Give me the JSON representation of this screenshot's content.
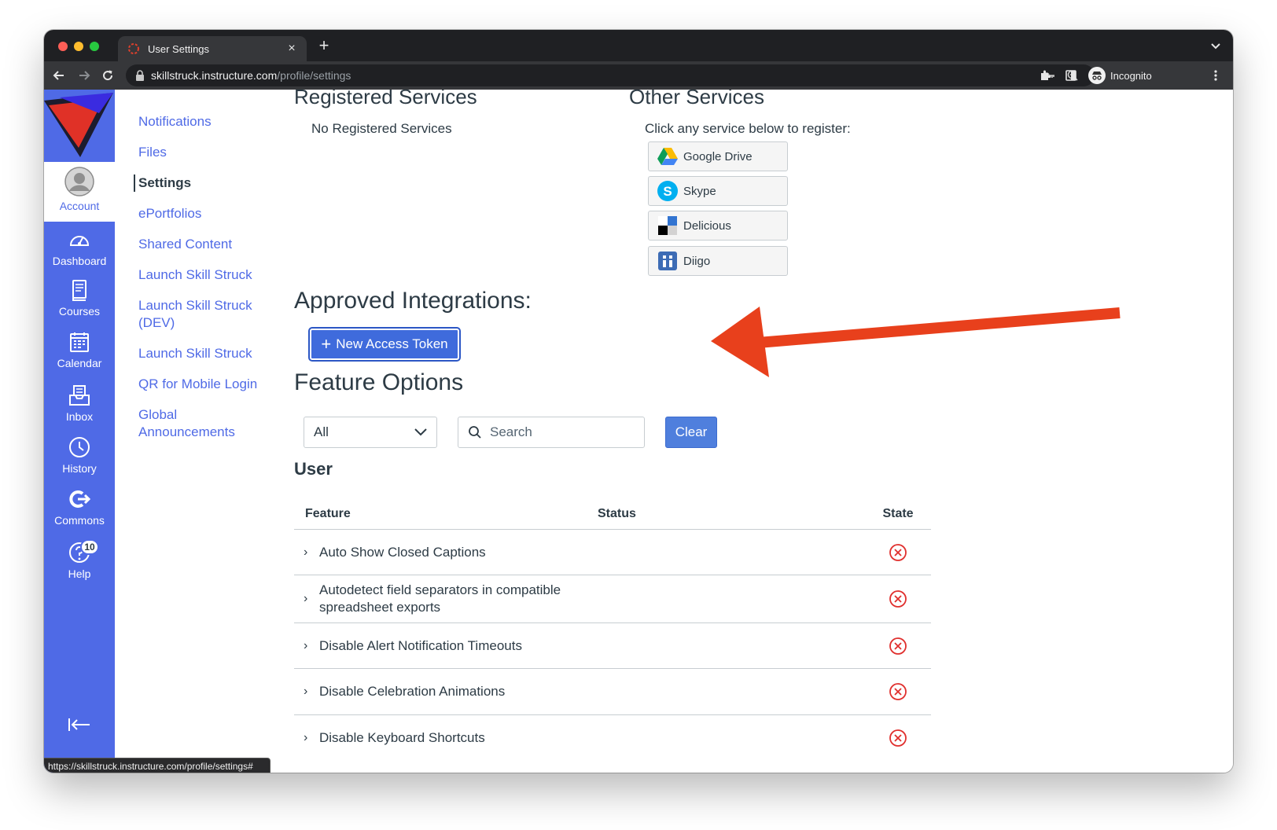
{
  "browser": {
    "tab_title": "User Settings",
    "url_host": "skillstruck.instructure.com",
    "url_path": "/profile/settings",
    "profile_label": "Incognito",
    "status_url": "https://skillstruck.instructure.com/profile/settings#"
  },
  "global_nav": {
    "account": "Account",
    "dashboard": "Dashboard",
    "courses": "Courses",
    "calendar": "Calendar",
    "inbox": "Inbox",
    "history": "History",
    "commons": "Commons",
    "help": "Help",
    "help_badge": "10"
  },
  "subnav": {
    "items": [
      {
        "label": "Notifications"
      },
      {
        "label": "Files"
      },
      {
        "label": "Settings"
      },
      {
        "label": "ePortfolios"
      },
      {
        "label": "Shared Content"
      },
      {
        "label": "Launch Skill Struck"
      },
      {
        "label": "Launch Skill Struck (DEV)"
      },
      {
        "label": "Launch Skill Struck"
      },
      {
        "label": "QR for Mobile Login"
      },
      {
        "label": "Global Announcements"
      }
    ],
    "active_index": 2
  },
  "registered_services": {
    "title": "Registered Services",
    "empty": "No Registered Services"
  },
  "other_services": {
    "title": "Other Services",
    "prompt": "Click any service below to register:",
    "services": [
      {
        "label": "Google Drive",
        "icon": "google-drive-icon"
      },
      {
        "label": "Skype",
        "icon": "skype-icon"
      },
      {
        "label": "Delicious",
        "icon": "delicious-icon"
      },
      {
        "label": "Diigo",
        "icon": "diigo-icon"
      }
    ]
  },
  "integrations": {
    "title": "Approved Integrations:",
    "new_token": "New Access Token"
  },
  "feature_options": {
    "title": "Feature Options",
    "filter_value": "All",
    "search_placeholder": "Search",
    "clear_label": "Clear",
    "section_title": "User",
    "columns": {
      "feature": "Feature",
      "status": "Status",
      "state": "State"
    },
    "rows": [
      {
        "feature": "Auto Show Closed Captions",
        "state": "off"
      },
      {
        "feature": "Autodetect field separators in compatible spreadsheet exports",
        "state": "off"
      },
      {
        "feature": "Disable Alert Notification Timeouts",
        "state": "off"
      },
      {
        "feature": "Disable Celebration Animations",
        "state": "off"
      },
      {
        "feature": "Disable Keyboard Shortcuts",
        "state": "off"
      }
    ]
  },
  "colors": {
    "brand_blue": "#4f6ae6",
    "button_blue": "#3f6bdc",
    "state_off_red": "#e0302e",
    "annotation_arrow": "#e8401c"
  }
}
